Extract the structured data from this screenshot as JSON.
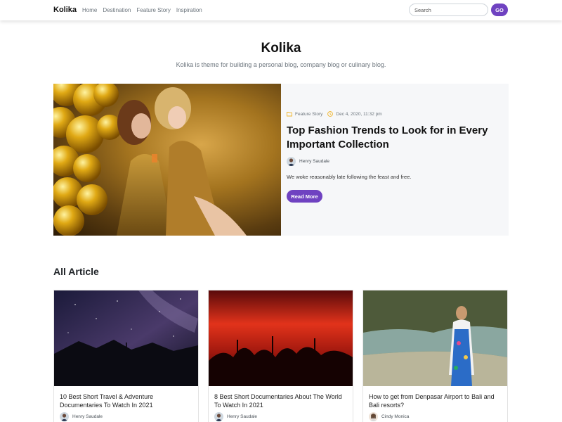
{
  "navbar": {
    "brand": "Kolika",
    "links": [
      "Home",
      "Destination",
      "Feature Story",
      "Inspiration"
    ],
    "search_placeholder": "Search",
    "go_label": "GO"
  },
  "hero": {
    "title": "Kolika",
    "tagline": "Kolika is theme for building a personal blog, company blog or culinary blog."
  },
  "featured": {
    "category": "Feature Story",
    "date": "Dec 4, 2020, 11:32 pm",
    "title": "Top Fashion Trends to Look for in Every Important Collection",
    "author": "Henry Saudale",
    "excerpt": "We woke reasonably late following the feast and free.",
    "read_more": "Read More"
  },
  "articles_section": {
    "title": "All Article",
    "cards": [
      {
        "title": "10 Best Short Travel & Adventure Documentaries To Watch In 2021",
        "author": "Henry Saudale"
      },
      {
        "title": "8 Best Short Documentaries About The World To Watch In 2021",
        "author": "Henry Saudale"
      },
      {
        "title": "How to get from Denpasar Airport to Bali and Bali resorts?",
        "author": "Cindy Monica"
      }
    ]
  },
  "colors": {
    "accent": "#6f42c1",
    "meta_icon": "#f0b429",
    "featured_bg": "#f6f7f9"
  }
}
